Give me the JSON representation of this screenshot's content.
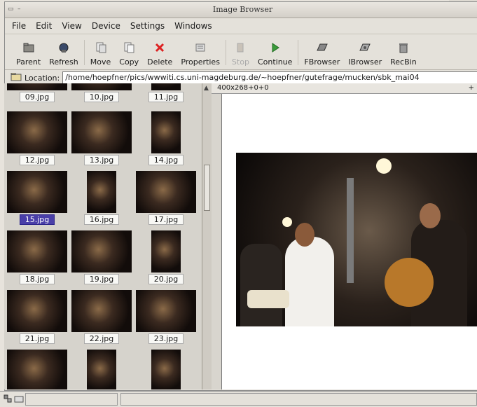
{
  "window": {
    "title": "Image Browser"
  },
  "menu": [
    "File",
    "Edit",
    "View",
    "Device",
    "Settings",
    "Windows"
  ],
  "toolbar": {
    "items": [
      {
        "label": "Parent",
        "icon": "parent-folder-icon",
        "enabled": true
      },
      {
        "label": "Refresh",
        "icon": "refresh-icon",
        "enabled": true
      },
      {
        "label": "Move",
        "icon": "move-icon",
        "enabled": true
      },
      {
        "label": "Copy",
        "icon": "copy-icon",
        "enabled": true
      },
      {
        "label": "Delete",
        "icon": "delete-icon",
        "enabled": true
      },
      {
        "label": "Properties",
        "icon": "properties-icon",
        "enabled": true
      },
      {
        "label": "Stop",
        "icon": "stop-icon",
        "enabled": false
      },
      {
        "label": "Continue",
        "icon": "continue-icon",
        "enabled": true
      },
      {
        "label": "FBrowser",
        "icon": "fbrowser-icon",
        "enabled": true
      },
      {
        "label": "IBrowser",
        "icon": "ibrowser-icon",
        "enabled": true
      },
      {
        "label": "RecBin",
        "icon": "recycle-bin-icon",
        "enabled": true
      }
    ]
  },
  "location": {
    "label": "Location:",
    "path": "/home/hoepfner/pics/wwwiti.cs.uni-magdeburg.de/~hoepfner/gutefrage/mucken/sbk_mai04"
  },
  "thumbnails": [
    {
      "name": "09.jpg"
    },
    {
      "name": "10.jpg"
    },
    {
      "name": "11.jpg"
    },
    {
      "name": "12.jpg"
    },
    {
      "name": "13.jpg"
    },
    {
      "name": "14.jpg"
    },
    {
      "name": "15.jpg",
      "selected": true
    },
    {
      "name": "16.jpg"
    },
    {
      "name": "17.jpg"
    },
    {
      "name": "18.jpg"
    },
    {
      "name": "19.jpg"
    },
    {
      "name": "20.jpg"
    },
    {
      "name": "21.jpg"
    },
    {
      "name": "22.jpg"
    },
    {
      "name": "23.jpg"
    },
    {
      "name": ""
    },
    {
      "name": ""
    },
    {
      "name": ""
    }
  ],
  "viewer": {
    "geometry": "400x268+0+0",
    "corner": "+"
  },
  "colors": {
    "selection": "#4a3fa8",
    "window_bg": "#e4e1da"
  }
}
